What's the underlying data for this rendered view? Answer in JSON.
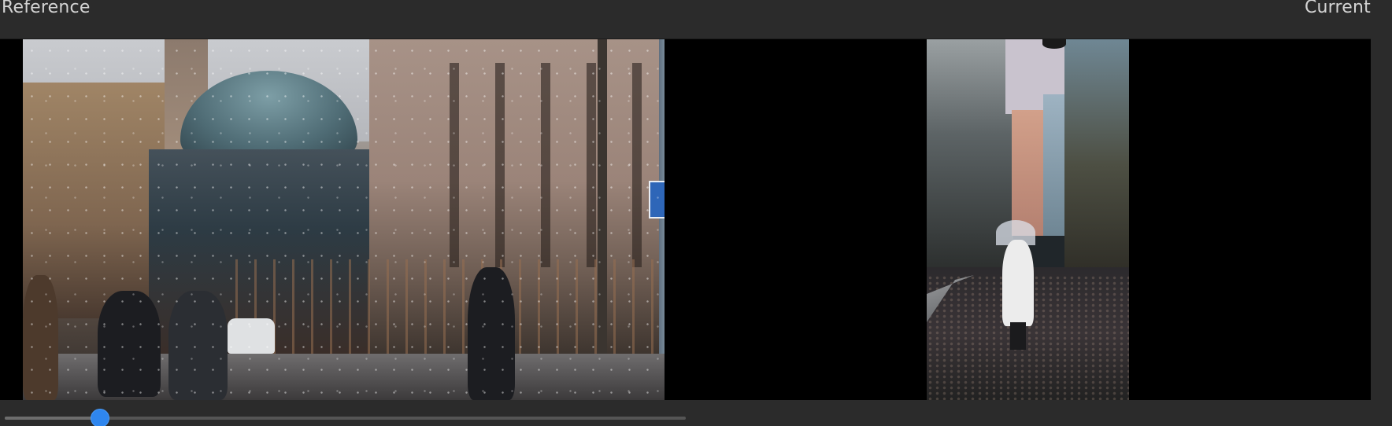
{
  "header": {
    "left_label": "Reference",
    "right_label": "Current"
  },
  "viewer": {
    "reference_image": "reference-photo",
    "current_image": "current-photo"
  },
  "slider": {
    "value_fraction": 0.14,
    "accent_color": "#2f86ee"
  },
  "colors": {
    "background": "#2b2b2b",
    "viewer_background": "#000000",
    "label_text": "#d4d4d4",
    "accent": "#2f86ee"
  }
}
